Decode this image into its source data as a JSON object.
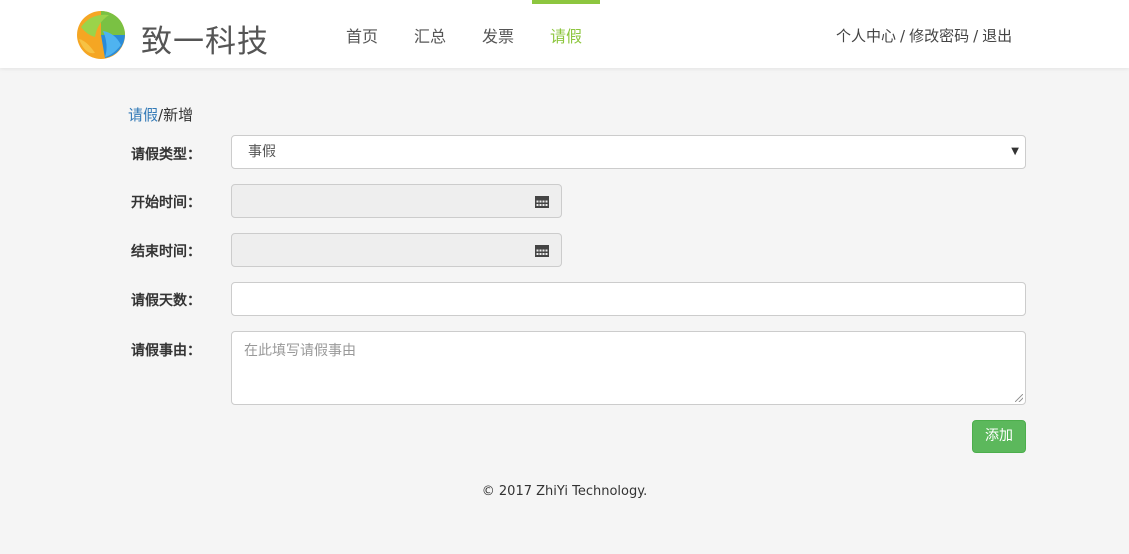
{
  "header": {
    "brand": "致一科技",
    "nav": [
      {
        "label": "首页",
        "active": false
      },
      {
        "label": "汇总",
        "active": false
      },
      {
        "label": "发票",
        "active": false
      },
      {
        "label": "请假",
        "active": true
      }
    ],
    "user_links": {
      "profile": "个人中心",
      "change_password": "修改密码",
      "logout": "退出",
      "separator": "/"
    },
    "accent_color": "#8dc63f"
  },
  "breadcrumb": {
    "parent": "请假",
    "separator": "/",
    "current": "新增"
  },
  "form": {
    "leave_type": {
      "label": "请假类型：",
      "value": "事假"
    },
    "start_time": {
      "label": "开始时间：",
      "value": "",
      "icon": "calendar-icon"
    },
    "end_time": {
      "label": "结束时间：",
      "value": "",
      "icon": "calendar-icon"
    },
    "days": {
      "label": "请假天数：",
      "value": ""
    },
    "reason": {
      "label": "请假事由：",
      "placeholder": "在此填写请假事由"
    },
    "submit_label": "添加",
    "submit_color": "#5cb85c"
  },
  "footer": {
    "copyright": "© 2017 ZhiYi Technology."
  }
}
